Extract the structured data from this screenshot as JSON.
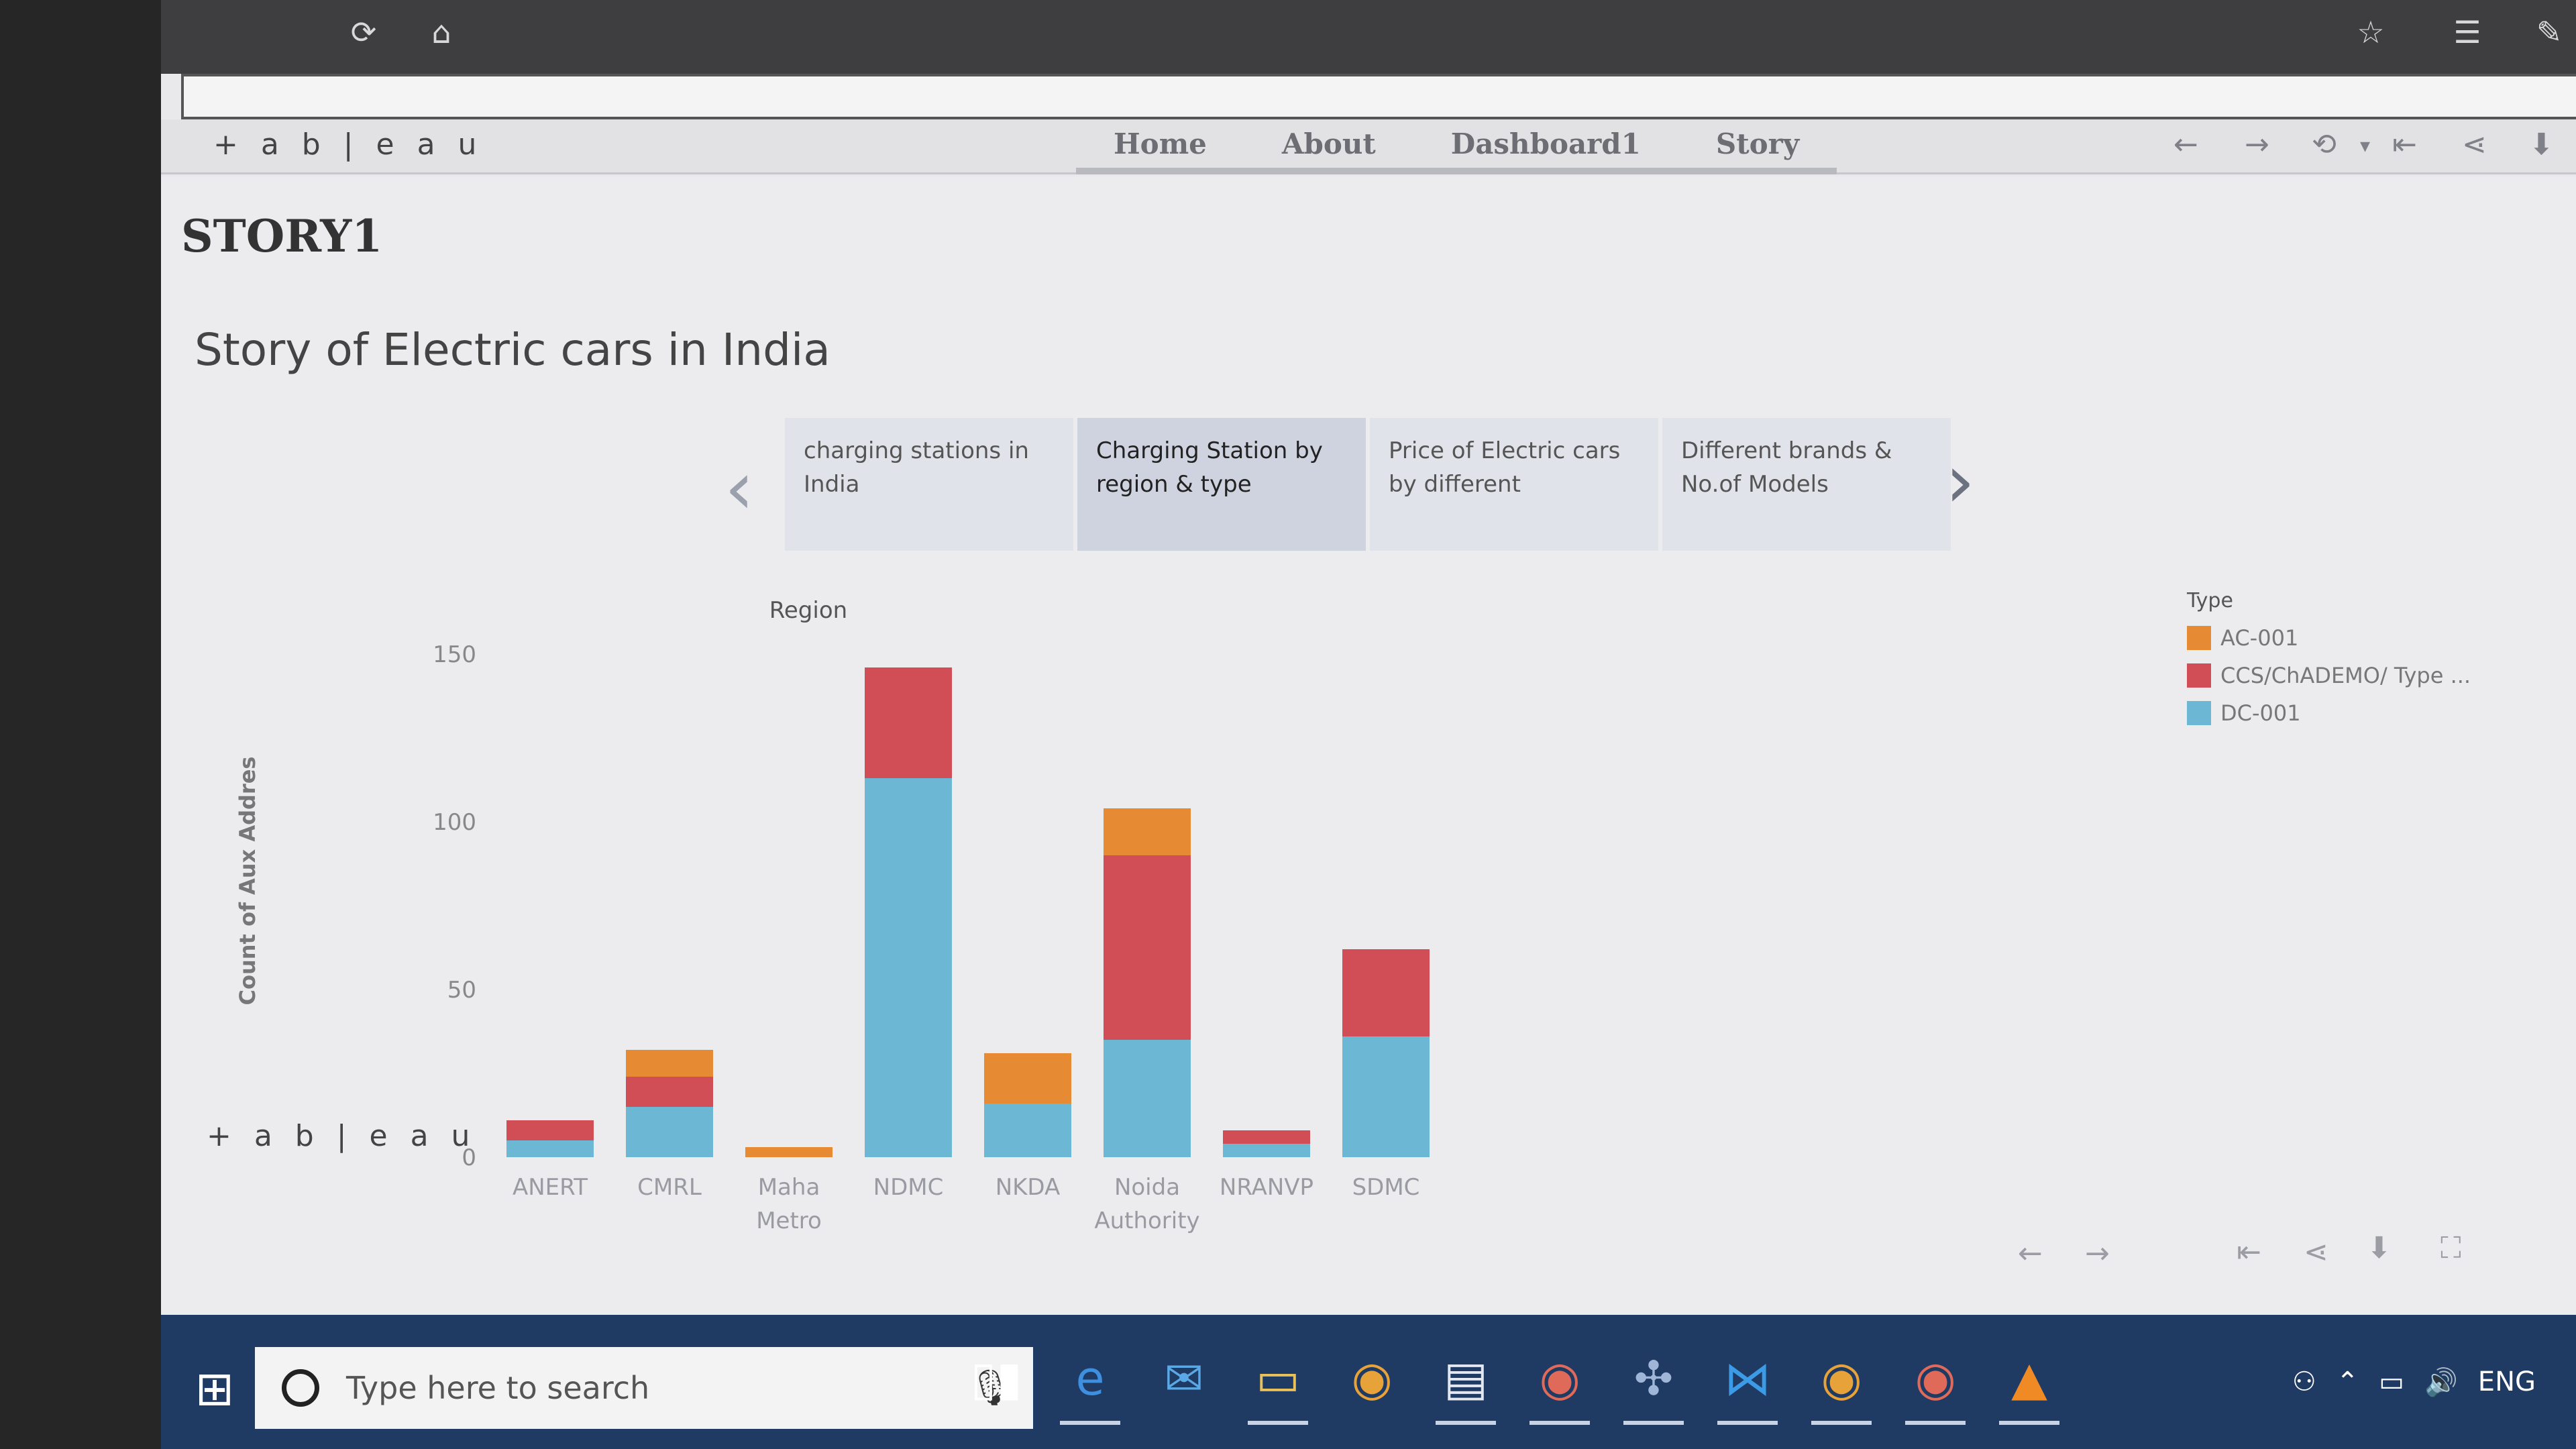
{
  "browser": {
    "refresh_icon": "refresh-icon",
    "home_icon": "home-icon",
    "favorites_icon": "star-icon",
    "collections_icon": "favorites-list-icon",
    "pen_icon": "pen-icon"
  },
  "tableau": {
    "logo_text": "+ a b | e a u",
    "nav": [
      "Home",
      "About",
      "Dashboard1",
      "Story"
    ],
    "story_title": "STORY1",
    "story_subtitle": "Story of Electric cars in India",
    "story_points": [
      "charging stations in India",
      "Charging Station by region & type",
      "Price of Electric cars by different",
      "Different brands & No.of Models"
    ],
    "active_story_point": 1,
    "bottom_logo_text": "+ a b | e a u"
  },
  "chart_data": {
    "type": "bar",
    "stacked": true,
    "title": "Region",
    "ylabel": "Count of Aux Addres",
    "xlabel": "",
    "ylim": [
      0,
      150
    ],
    "yticks": [
      0,
      50,
      100,
      150
    ],
    "categories": [
      "ANERT",
      "CMRL",
      "Maha Metro",
      "NDMC",
      "NKDA",
      "Noida Authority",
      "NRANVP",
      "SDMC"
    ],
    "legend_title": "Type",
    "legend_position": "top-right",
    "series": [
      {
        "name": "DC-001",
        "color": "#6bb7d4",
        "values": [
          5,
          15,
          0,
          113,
          16,
          35,
          4,
          36
        ]
      },
      {
        "name": "CCS/ChADEMO/ Type ...",
        "color": "#d24e56",
        "values": [
          6,
          9,
          0,
          33,
          0,
          55,
          4,
          26
        ]
      },
      {
        "name": "AC-001",
        "color": "#e68a34",
        "values": [
          0,
          8,
          3,
          0,
          15,
          14,
          0,
          0
        ]
      }
    ]
  },
  "taskbar": {
    "search_placeholder": "Type here to search",
    "tray_language": "ENG"
  }
}
